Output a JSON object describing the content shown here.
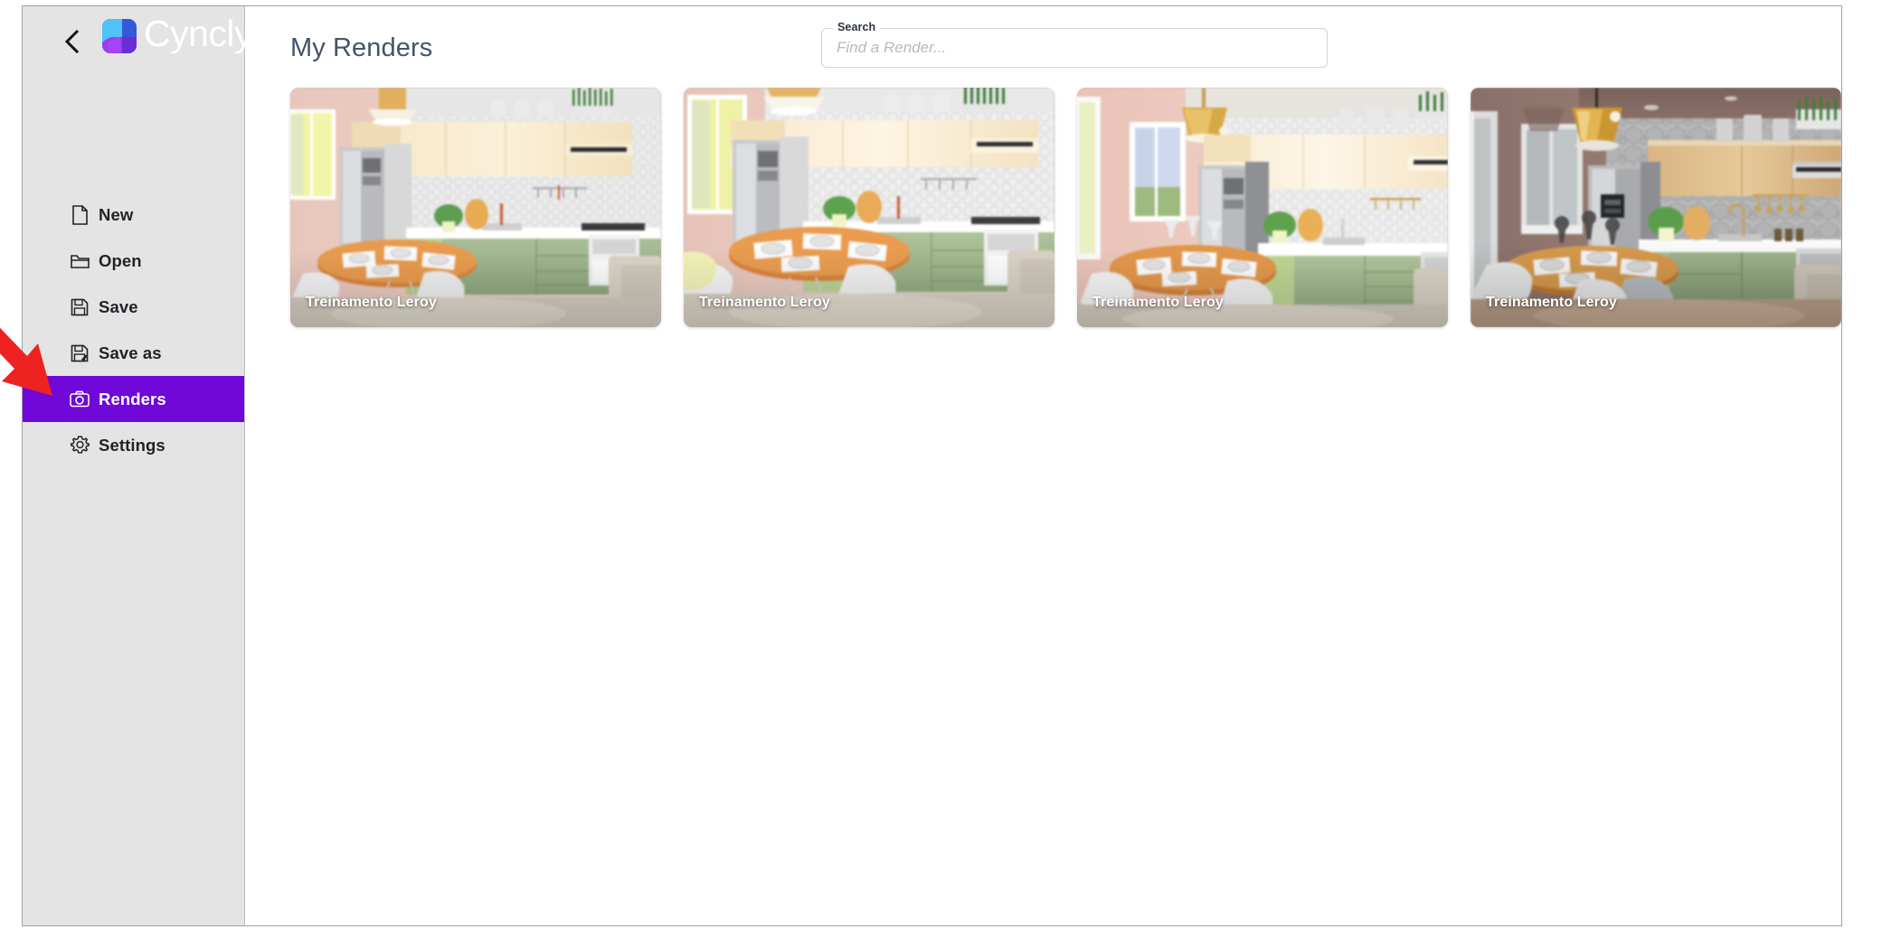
{
  "window": {
    "title": "Cyncly"
  },
  "sidebar": {
    "back_icon": "chevron-left-icon",
    "brand_name": "Cyncly",
    "brand_mark_icon": "cyncly-logo-icon",
    "items": [
      {
        "id": "new",
        "label": "New",
        "icon": "file-icon",
        "active": false
      },
      {
        "id": "open",
        "label": "Open",
        "icon": "folder-icon",
        "active": false
      },
      {
        "id": "save",
        "label": "Save",
        "icon": "floppy-icon",
        "active": false
      },
      {
        "id": "save-as",
        "label": "Save as",
        "icon": "floppy-pen-icon",
        "active": false
      },
      {
        "id": "renders",
        "label": "Renders",
        "icon": "camera-icon",
        "active": true
      },
      {
        "id": "settings",
        "label": "Settings",
        "icon": "gear-icon",
        "active": false
      }
    ]
  },
  "main": {
    "page_title": "My Renders",
    "search": {
      "legend": "Search",
      "placeholder": "Find a Render...",
      "value": ""
    },
    "renders": [
      {
        "id": "render-1",
        "label": "Treinamento Leroy",
        "variant": "pale"
      },
      {
        "id": "render-2",
        "label": "Treinamento Leroy",
        "variant": "pale-zoom"
      },
      {
        "id": "render-3",
        "label": "Treinamento Leroy",
        "variant": "pink-gold"
      },
      {
        "id": "render-4",
        "label": "Treinamento Leroy",
        "variant": "dark-gold"
      }
    ]
  },
  "annotation": {
    "arrow": "red-arrow-pointing-to-renders",
    "color": "#ef2222"
  },
  "colors": {
    "sidebar_bg": "#e4e4e4",
    "active_item": "#6f08d8",
    "page_title": "#44546a",
    "annotation_red": "#ef2222",
    "window_border": "#9aa3ad"
  }
}
